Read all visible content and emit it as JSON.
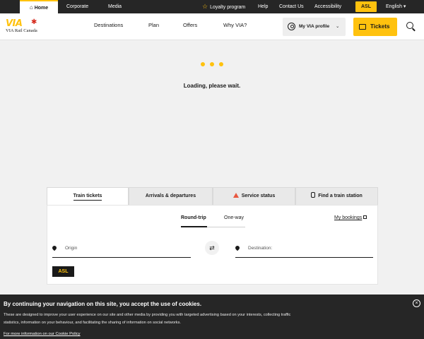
{
  "topbar": {
    "home": "Home",
    "corporate": "Corporate",
    "media": "Media",
    "loyalty": "Loyalty program",
    "help": "Help",
    "contact": "Contact Us",
    "accessibility": "Accessibility",
    "asl": "ASL",
    "language": "English ▾"
  },
  "logo": {
    "mark": "VIA",
    "sub": "VIA Rail Canada"
  },
  "nav": {
    "destinations": "Destinations",
    "plan": "Plan",
    "offers": "Offers",
    "why": "Why VIA?",
    "profile": "My VIA profile",
    "tickets": "Tickets"
  },
  "loading": {
    "text": "Loading, please wait."
  },
  "booking": {
    "tabs": [
      "Train tickets",
      "Arrivals & departures",
      "Service status",
      "Find a train station"
    ],
    "trip_types": [
      "Round-trip",
      "One-way"
    ],
    "my_bookings": "My bookings",
    "origin_placeholder": "Origin",
    "destination_placeholder": "Destination:",
    "asl": "ASL"
  },
  "cookie": {
    "title": "By continuing your navigation on this site, you accept the use of cookies.",
    "body_line1": "These are designed to improve your user experience on our site and other media by providing you with targeted advertising based on your interests, collecting traffic",
    "body_line2": "statistics, information on your behaviour, and facilitating the sharing of information on social networks.",
    "more": "For more information on our Cookie Policy"
  },
  "colors": {
    "brand_yellow": "#ffc20e",
    "dark": "#262626",
    "warning": "#e8573f",
    "maple": "#d52b1e"
  },
  "icons": [
    "home-icon",
    "star-icon",
    "maple-leaf-icon",
    "profile-icon",
    "chevron-down-icon",
    "ticket-icon",
    "search-icon",
    "warning-icon",
    "train-icon",
    "external-link-icon",
    "location-pin-icon",
    "swap-icon",
    "close-icon"
  ]
}
